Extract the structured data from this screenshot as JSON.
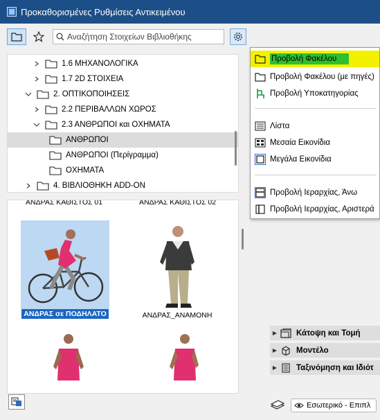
{
  "window": {
    "title": "Προκαθορισμένες Ρυθμίσεις Αντικειμένου"
  },
  "toolbar": {
    "search_placeholder": "Αναζήτηση Στοιχείων Βιβλιοθήκης"
  },
  "tree": {
    "items": [
      {
        "label": "1.6 ΜΗΧΑΝΟΛΟΓΙΚΑ",
        "expanded": false
      },
      {
        "label": "1.7 2D ΣΤΟΙΧΕΙΑ",
        "expanded": false
      },
      {
        "label": "2. ΟΠΤΙΚΟΠΟΙΗΣΕΙΣ",
        "expanded": true
      },
      {
        "label": "2.2 ΠΕΡΙΒΑΛΛΩΝ ΧΩΡΟΣ",
        "expanded": false
      },
      {
        "label": "2.3 ΑΝΘΡΩΠΟΙ και ΟΧΗΜΑΤΑ",
        "expanded": true
      },
      {
        "label": "ΑΝΘΡΩΠΟΙ",
        "selected": true
      },
      {
        "label": "ΑΝΘΡΩΠΟΙ (Περίγραμμα)"
      },
      {
        "label": "ΟΧΗΜΑΤΑ"
      },
      {
        "label": "4. ΒΙΒΛΙΟΘΗΚΗ ADD-ON",
        "expanded": false
      }
    ]
  },
  "thumbs": {
    "top_captions": [
      "ΑΝΔΡΑΣ ΚΑΘΙΣΤΟΣ 01",
      "ΑΝΔΡΑΣ ΚΑΘΙΣΤΟΣ 02"
    ],
    "items": [
      {
        "caption": "ΑΝΔΡΑΣ σε ΠΟΔΗΛΑΤΟ",
        "selected": true
      },
      {
        "caption": "ΑΝΔΡΑΣ_ΑΝΑΜΟΝΗ",
        "selected": false
      }
    ]
  },
  "menu": {
    "items": [
      {
        "label": "Προβολή Φακέλου",
        "icon": "folder-icon",
        "highlighted": true
      },
      {
        "label": "Προβολή Φακέλου (με πηγές)",
        "icon": "folder-icon"
      },
      {
        "label": "Προβολή Υποκατηγορίας",
        "icon": "subcategory-icon"
      },
      {
        "label": "Λίστα",
        "icon": "list-icon"
      },
      {
        "label": "Μεσαία Εικονίδια",
        "icon": "medium-icons-icon"
      },
      {
        "label": "Μεγάλα Εικονίδια",
        "icon": "large-icons-icon"
      },
      {
        "label": "Προβολή Ιεραρχίας, Άνω",
        "icon": "hierarchy-top-icon"
      },
      {
        "label": "Προβολή Ιεραρχίας, Αριστερά",
        "icon": "hierarchy-left-icon"
      }
    ]
  },
  "panels": {
    "items": [
      {
        "label": "Κάτοψη και Τομή"
      },
      {
        "label": "Μοντέλο"
      },
      {
        "label": "Ταξινόμηση και Ιδιότ"
      }
    ]
  },
  "viewbar": {
    "view_label": "Εσωτερικό - Επιπλ"
  },
  "colors": {
    "titlebar": "#1c4f87",
    "highlight_yellow": "#f3f000",
    "highlight_green": "#2fbf2f",
    "selection_blue": "#1b66c2"
  }
}
